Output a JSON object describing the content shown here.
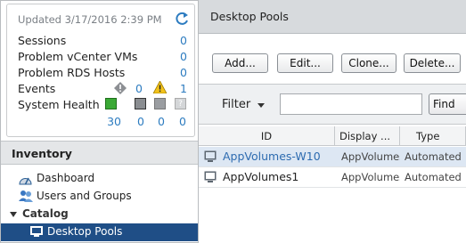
{
  "status": {
    "updated": "Updated 3/17/2016 2:39 PM",
    "rows": [
      {
        "label": "Sessions",
        "value": "0"
      },
      {
        "label": "Problem vCenter VMs",
        "value": "0"
      },
      {
        "label": "Problem RDS Hosts",
        "value": "0"
      },
      {
        "label": "Events",
        "values": [
          "0",
          "1"
        ]
      },
      {
        "label": "System Health",
        "values": [
          "30",
          "0",
          "0",
          "0"
        ]
      }
    ]
  },
  "inventory": {
    "heading": "Inventory",
    "items": [
      {
        "label": "Dashboard"
      },
      {
        "label": "Users and Groups"
      },
      {
        "label": "Catalog"
      },
      {
        "label": "Desktop Pools"
      }
    ]
  },
  "main": {
    "title": "Desktop Pools",
    "buttons": [
      "Add...",
      "Edit...",
      "Clone...",
      "Delete..."
    ],
    "filter": {
      "label": "Filter",
      "value": "",
      "find": "Find"
    },
    "columns": [
      "ID",
      "Display ...",
      "Type"
    ],
    "rows": [
      {
        "id": "AppVolumes-W10",
        "display": "AppVolumes",
        "type": "Automated"
      },
      {
        "id": "AppVolumes1",
        "display": "AppVolumes",
        "type": "Automated"
      }
    ]
  },
  "colors": {
    "link": "#2d7cc0",
    "selected": "#1f4e86",
    "health_green": "#3aa935"
  }
}
